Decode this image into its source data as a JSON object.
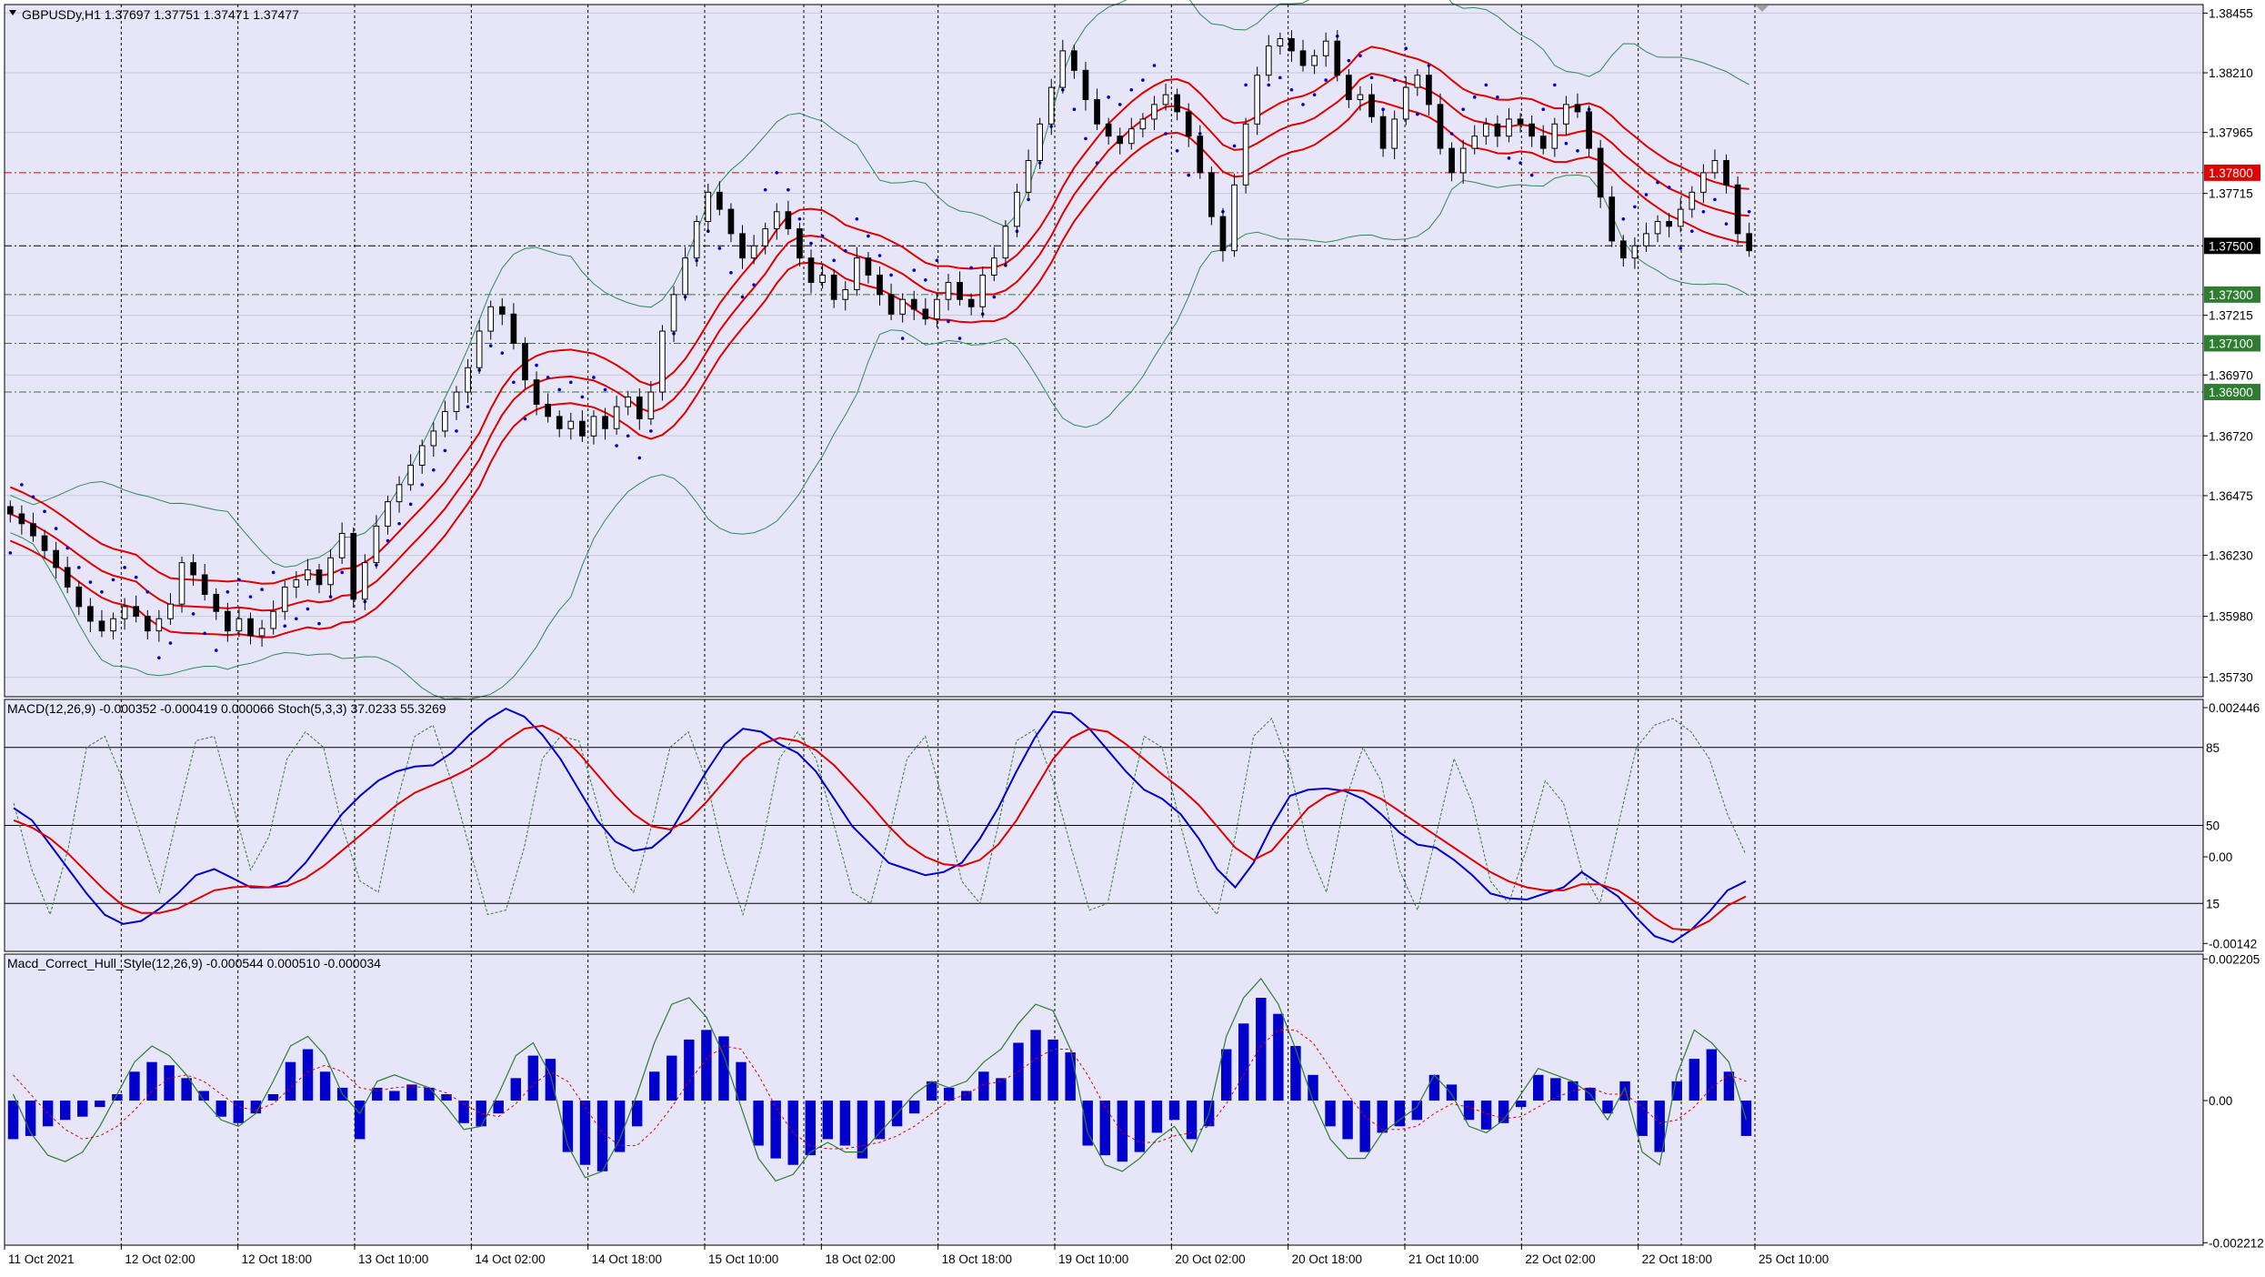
{
  "colors": {
    "chart_bg": "#e6e6f8",
    "frame": "#000000",
    "grid": "#000000",
    "candle": "#000000",
    "bands_outer": "#2e8b57",
    "envelope": "#e00000",
    "sar": "#0000cc",
    "macd_main": "#0000cc",
    "macd_signal": "#e00000",
    "stoch": "#2e7d32",
    "hist": "#0000cc",
    "resistance": "#e00000",
    "support": "#2e7d32",
    "current_price": "#000000"
  },
  "chart_data": [
    {
      "type": "line",
      "title": "GBPUSDy,H1  1.37697 1.37751 1.37471 1.37477",
      "y_ticks": [
        "1.38455",
        "1.38210",
        "1.37965",
        "1.37715",
        "1.37215",
        "1.36970",
        "1.36720",
        "1.36475",
        "1.36230",
        "1.35980",
        "1.35730"
      ],
      "y_tick_values": [
        1.38455,
        1.3821,
        1.37965,
        1.37715,
        1.37215,
        1.3697,
        1.3672,
        1.36475,
        1.3623,
        1.3598,
        1.3573
      ],
      "ylim": [
        1.3565,
        1.3849
      ],
      "x_ticks": [
        "11 Oct 2021",
        "12 Oct 02:00",
        "12 Oct 18:00",
        "13 Oct 10:00",
        "14 Oct 02:00",
        "14 Oct 18:00",
        "15 Oct 10:00",
        "18 Oct 02:00",
        "18 Oct 18:00",
        "19 Oct 10:00",
        "20 Oct 02:00",
        "20 Oct 18:00",
        "21 Oct 10:00",
        "22 Oct 02:00",
        "22 Oct 18:00",
        "25 Oct 10:00"
      ],
      "grid": true,
      "levels": [
        {
          "label": "1.37800",
          "value": 1.378,
          "color": "#e00000"
        },
        {
          "label": "1.37500",
          "value": 1.375,
          "color": "#000000"
        },
        {
          "label": "1.37300",
          "value": 1.373,
          "color": "#2e7d32"
        },
        {
          "label": "1.37100",
          "value": 1.371,
          "color": "#2e7d32"
        },
        {
          "label": "1.36900",
          "value": 1.369,
          "color": "#2e7d32"
        }
      ],
      "close_series": [
        1.364,
        1.3636,
        1.3631,
        1.3625,
        1.3618,
        1.361,
        1.3602,
        1.3596,
        1.3592,
        1.3597,
        1.3602,
        1.3598,
        1.3592,
        1.3597,
        1.3603,
        1.362,
        1.3615,
        1.3607,
        1.36,
        1.3592,
        1.3597,
        1.359,
        1.3593,
        1.36,
        1.361,
        1.3613,
        1.3617,
        1.3611,
        1.3622,
        1.3632,
        1.3605,
        1.362,
        1.3635,
        1.3645,
        1.3652,
        1.366,
        1.3668,
        1.3674,
        1.3682,
        1.369,
        1.37,
        1.3715,
        1.3725,
        1.3722,
        1.371,
        1.3695,
        1.3685,
        1.368,
        1.3675,
        1.3678,
        1.3672,
        1.368,
        1.3675,
        1.3684,
        1.3688,
        1.3679,
        1.369,
        1.3715,
        1.373,
        1.3745,
        1.376,
        1.3772,
        1.3765,
        1.3755,
        1.3745,
        1.375,
        1.3757,
        1.3764,
        1.3757,
        1.3745,
        1.3735,
        1.3738,
        1.3728,
        1.3732,
        1.3745,
        1.3738,
        1.373,
        1.3722,
        1.3728,
        1.3724,
        1.372,
        1.3728,
        1.3735,
        1.3728,
        1.3725,
        1.3738,
        1.3745,
        1.3758,
        1.3772,
        1.3785,
        1.38,
        1.3815,
        1.383,
        1.3822,
        1.381,
        1.38,
        1.3795,
        1.3792,
        1.3798,
        1.3802,
        1.3808,
        1.3812,
        1.3805,
        1.3795,
        1.378,
        1.3762,
        1.3748,
        1.3775,
        1.38,
        1.382,
        1.3832,
        1.3835,
        1.383,
        1.3824,
        1.3828,
        1.3834,
        1.382,
        1.381,
        1.3812,
        1.3803,
        1.379,
        1.3802,
        1.3815,
        1.382,
        1.3808,
        1.379,
        1.378,
        1.379,
        1.3795,
        1.38,
        1.3795,
        1.3802,
        1.38,
        1.3795,
        1.379,
        1.38,
        1.3808,
        1.3805,
        1.379,
        1.377,
        1.3752,
        1.3745,
        1.375,
        1.3755,
        1.376,
        1.3758,
        1.3765,
        1.3772,
        1.378,
        1.3785,
        1.3775,
        1.3755,
        1.3748
      ]
    },
    {
      "type": "line",
      "title": "MACD(12,26,9) -0.000352 -0.000419 0.000066  Stoch(5,3,3) 37.0233 55.3269",
      "y_ticks": [
        "0.002446",
        "0.00",
        "-0.00142"
      ],
      "y_tick_values": [
        0.002446,
        0.0,
        -0.00142
      ],
      "ylim": [
        -0.00155,
        0.00258
      ],
      "stoch_levels": [
        "85",
        "50",
        "15"
      ],
      "stoch_level_values": [
        85,
        50,
        15
      ],
      "macd_main": [
        0.0008,
        0.0006,
        0.0002,
        -0.0002,
        -0.0006,
        -0.00095,
        -0.0011,
        -0.00105,
        -0.00085,
        -0.0006,
        -0.0003,
        -0.0002,
        -0.00035,
        -0.0005,
        -0.0005,
        -0.0004,
        -0.0001,
        0.0003,
        0.0007,
        0.001,
        0.00125,
        0.0014,
        0.00148,
        0.0015,
        0.0017,
        0.002,
        0.00225,
        0.00243,
        0.0023,
        0.002,
        0.0016,
        0.0011,
        0.0006,
        0.00025,
        0.0001,
        0.00015,
        0.0004,
        0.0009,
        0.0014,
        0.00185,
        0.0021,
        0.00205,
        0.00185,
        0.0017,
        0.0014,
        0.00095,
        0.0005,
        0.0002,
        -0.0001,
        -0.0002,
        -0.0003,
        -0.00025,
        -0.0001,
        0.0003,
        0.0008,
        0.0014,
        0.00195,
        0.00238,
        0.00235,
        0.0021,
        0.00175,
        0.0014,
        0.0011,
        0.00095,
        0.0007,
        0.0003,
        -0.0002,
        -0.0005,
        -0.0001,
        0.0005,
        0.001,
        0.0011,
        0.00112,
        0.00108,
        0.00095,
        0.0007,
        0.0004,
        0.0002,
        0.00015,
        -5e-05,
        -0.0003,
        -0.0006,
        -0.00068,
        -0.0007,
        -0.0006,
        -0.0005,
        -0.00025,
        -0.00045,
        -0.00065,
        -0.001,
        -0.0013,
        -0.0014,
        -0.0012,
        -0.0009,
        -0.00055,
        -0.0004
      ],
      "macd_signal": [
        0.0006,
        0.00048,
        0.0003,
        5e-05,
        -0.00025,
        -0.00055,
        -0.0008,
        -0.00092,
        -0.00092,
        -0.00085,
        -0.0007,
        -0.00055,
        -0.0005,
        -0.00048,
        -0.0005,
        -0.00048,
        -0.00035,
        -0.00015,
        0.0001,
        0.00035,
        0.0006,
        0.00085,
        0.00105,
        0.00118,
        0.0013,
        0.00145,
        0.00165,
        0.0019,
        0.0021,
        0.00215,
        0.002,
        0.0017,
        0.00135,
        0.001,
        0.0007,
        0.0005,
        0.00045,
        0.0006,
        0.0009,
        0.00125,
        0.0016,
        0.00185,
        0.00195,
        0.0019,
        0.00175,
        0.0015,
        0.00118,
        0.00085,
        0.0005,
        0.0002,
        0.0,
        -0.00012,
        -0.00015,
        -5e-05,
        0.0002,
        0.0006,
        0.0011,
        0.0016,
        0.00195,
        0.0021,
        0.00205,
        0.00185,
        0.0016,
        0.00135,
        0.00112,
        0.00085,
        0.0005,
        0.00015,
        -5e-05,
        0.0001,
        0.00045,
        0.0008,
        0.001,
        0.0011,
        0.00108,
        0.00095,
        0.00075,
        0.00055,
        0.00035,
        0.00015,
        -5e-05,
        -0.00025,
        -0.0004,
        -0.0005,
        -0.00055,
        -0.00055,
        -0.00045,
        -0.00045,
        -0.00055,
        -0.00075,
        -0.001,
        -0.00118,
        -0.0012,
        -0.00105,
        -0.0008,
        -0.00065
      ],
      "stoch_main": [
        60,
        30,
        10,
        40,
        85,
        90,
        70,
        45,
        20,
        55,
        88,
        90,
        60,
        30,
        45,
        80,
        92,
        85,
        50,
        25,
        20,
        60,
        90,
        95,
        70,
        40,
        10,
        12,
        40,
        80,
        90,
        88,
        60,
        30,
        20,
        50,
        85,
        92,
        70,
        35,
        10,
        40,
        80,
        92,
        80,
        50,
        20,
        15,
        45,
        80,
        90,
        60,
        25,
        15,
        50,
        88,
        93,
        70,
        40,
        12,
        15,
        55,
        90,
        85,
        50,
        20,
        10,
        45,
        90,
        98,
        75,
        40,
        20,
        60,
        85,
        70,
        30,
        12,
        45,
        80,
        60,
        25,
        15,
        40,
        70,
        60,
        30,
        15,
        50,
        85,
        95,
        98,
        92,
        80,
        55,
        37
      ]
    },
    {
      "type": "bar",
      "title": "Macd_Correct_Hull_Style(12,26,9) -0.000544 0.000510 -0.000034",
      "y_ticks": [
        "0.002205",
        "0.00",
        "-0.002212"
      ],
      "y_tick_values": [
        0.002205,
        0.0,
        -0.002212
      ],
      "ylim": [
        -0.00225,
        0.00228
      ],
      "values": [
        -0.0006,
        -0.00055,
        -0.0004,
        -0.0003,
        -0.00025,
        -0.0001,
        0.0001,
        0.00045,
        0.0006,
        0.00055,
        0.00035,
        0.00015,
        -0.00025,
        -0.00035,
        -0.0002,
        0.0001,
        0.0006,
        0.0008,
        0.00045,
        0.0002,
        -0.0006,
        0.0002,
        0.00015,
        0.00025,
        0.0002,
        0.0001,
        -0.00035,
        -0.0004,
        -0.0002,
        0.00035,
        0.0007,
        0.00065,
        -0.0008,
        -0.001,
        -0.0011,
        -0.0008,
        -0.0004,
        0.00045,
        0.0007,
        0.00095,
        0.0011,
        0.001,
        0.0006,
        -0.0007,
        -0.0009,
        -0.001,
        -0.00085,
        -0.0006,
        -0.0007,
        -0.0009,
        -0.0006,
        -0.0004,
        -0.0002,
        0.0003,
        0.0002,
        0.00015,
        0.00045,
        0.00035,
        0.0009,
        0.0011,
        0.00095,
        0.00075,
        -0.0007,
        -0.00085,
        -0.00095,
        -0.0008,
        -0.0005,
        -0.0003,
        -0.0006,
        -0.0004,
        0.0008,
        0.0012,
        0.0016,
        0.00135,
        0.00085,
        0.0004,
        -0.0004,
        -0.0006,
        -0.0008,
        -0.0005,
        -0.0004,
        -0.0003,
        0.0004,
        0.00025,
        -0.0003,
        -0.00045,
        -0.00035,
        -0.0001,
        0.0004,
        0.00035,
        0.0003,
        0.0002,
        -0.0002,
        0.0003,
        -0.00055,
        -0.0008,
        0.0003,
        0.00065,
        0.0008,
        0.00045,
        -0.00055
      ],
      "signal": [
        0.0004,
        0.0001,
        -0.0002,
        -0.00045,
        -0.0006,
        -0.00055,
        -0.0004,
        -0.00015,
        0.00015,
        0.00035,
        0.0004,
        0.0003,
        0.0001,
        -0.0001,
        -0.00015,
        -5e-05,
        0.0002,
        0.00045,
        0.00055,
        0.00045,
        0.0002,
        0.00015,
        0.0002,
        0.00022,
        0.0002,
        0.00012,
        -5e-05,
        -0.0002,
        -0.00025,
        -5e-05,
        0.00025,
        0.00045,
        0.0003,
        -0.0001,
        -0.0005,
        -0.0007,
        -0.0007,
        -0.00045,
        -0.0001,
        0.0003,
        0.00065,
        0.00085,
        0.0008,
        0.0004,
        -0.0001,
        -0.0005,
        -0.0007,
        -0.00075,
        -0.00075,
        -0.0007,
        -0.00065,
        -0.00055,
        -0.0004,
        -0.0002,
        0.0,
        0.0001,
        0.00025,
        0.0003,
        0.00045,
        0.00065,
        0.0008,
        0.0008,
        0.0004,
        -0.0001,
        -0.0005,
        -0.00065,
        -0.00065,
        -0.00055,
        -0.0005,
        -0.0004,
        -5e-05,
        0.0004,
        0.00085,
        0.0011,
        0.0011,
        0.0009,
        0.0005,
        0.0001,
        -0.00025,
        -0.00045,
        -0.00045,
        -0.0004,
        -0.0002,
        -5e-05,
        -0.0001,
        -0.0002,
        -0.00028,
        -0.00025,
        -0.0001,
        5e-05,
        0.00015,
        0.0002,
        0.0001,
        0.0001,
        -0.0001,
        -0.00035,
        -0.0003,
        -0.0001,
        0.0002,
        0.0004,
        0.0003
      ],
      "hull": [
        0.0001,
        -0.0005,
        -0.00085,
        -0.00095,
        -0.0008,
        -0.0004,
        0.0001,
        0.0006,
        0.00085,
        0.0007,
        0.0004,
        0.0,
        -0.0003,
        -0.0004,
        -0.0002,
        0.0003,
        0.00085,
        0.001,
        0.0007,
        0.0001,
        -0.0002,
        0.0003,
        0.0004,
        0.0003,
        0.0002,
        -0.0001,
        -0.00045,
        -0.0004,
        0.0001,
        0.0007,
        0.0009,
        0.0004,
        -0.0007,
        -0.0012,
        -0.0011,
        -0.0006,
        0.0001,
        0.0009,
        0.0015,
        0.0016,
        0.0013,
        0.0007,
        -0.0001,
        -0.0009,
        -0.00125,
        -0.00115,
        -0.0008,
        -0.00065,
        -0.0008,
        -0.0008,
        -0.0005,
        -0.0002,
        0.0001,
        0.0003,
        0.0002,
        0.0003,
        0.0006,
        0.0008,
        0.0012,
        0.0015,
        0.0014,
        0.0008,
        -0.0005,
        -0.001,
        -0.0011,
        -0.0009,
        -0.0006,
        -0.0004,
        -0.0008,
        -0.0002,
        0.001,
        0.0016,
        0.0019,
        0.0015,
        0.0008,
        0.0,
        -0.0006,
        -0.0009,
        -0.0009,
        -0.0005,
        -0.0003,
        -0.0001,
        0.0004,
        0.0001,
        -0.0004,
        -0.0005,
        -0.0003,
        0.0001,
        0.0005,
        0.0004,
        0.0003,
        0.0001,
        -0.0003,
        0.0002,
        -0.0008,
        -0.001,
        0.0004,
        0.0011,
        0.0009,
        0.0006,
        -0.0003
      ]
    }
  ]
}
